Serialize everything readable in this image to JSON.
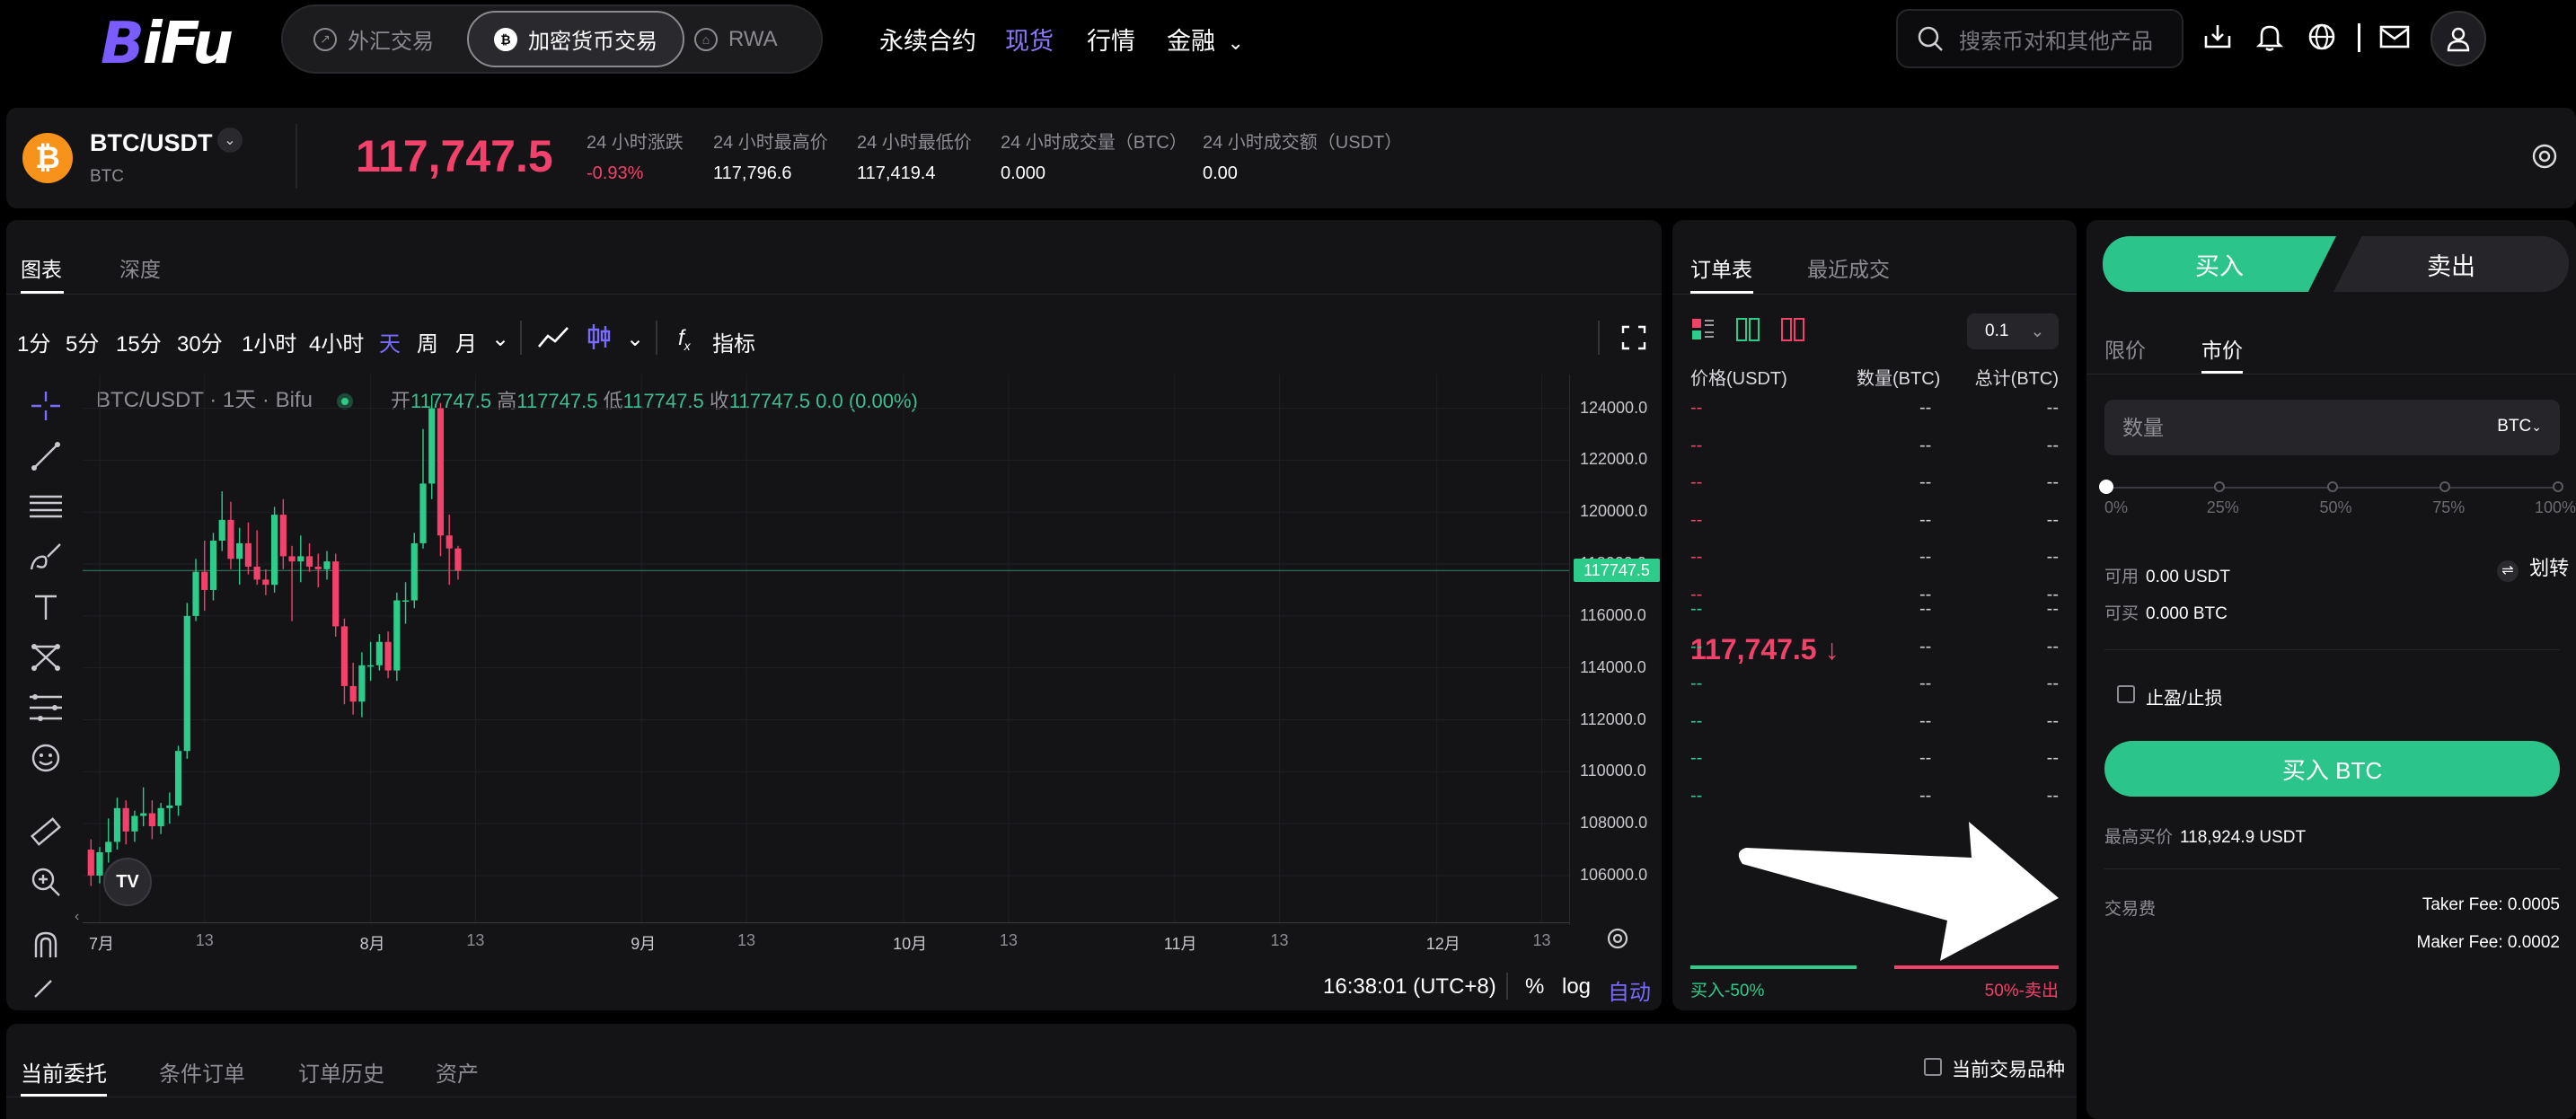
{
  "header": {
    "logo": "BiFu",
    "segments": [
      {
        "label": "外汇交易",
        "active": false
      },
      {
        "label": "加密货币交易",
        "active": true
      },
      {
        "label": "RWA",
        "active": false
      }
    ],
    "nav": [
      {
        "label": "永续合约",
        "active": false
      },
      {
        "label": "现货",
        "active": true
      },
      {
        "label": "行情",
        "active": false
      },
      {
        "label": "金融",
        "active": false
      }
    ],
    "search_placeholder": "搜索币对和其他产品",
    "icons": [
      "download-icon",
      "bell-icon",
      "globe-icon",
      "mail-icon",
      "user-icon"
    ]
  },
  "ticker": {
    "pair": "BTC/USDT",
    "base": "BTC",
    "last_price": "117,747.5",
    "stats": [
      {
        "label": "24 小时涨跌",
        "value": "-0.93%"
      },
      {
        "label": "24 小时最高价",
        "value": "117,796.6"
      },
      {
        "label": "24 小时最低价",
        "value": "117,419.4"
      },
      {
        "label": "24 小时成交量（BTC）",
        "value": "0.000"
      },
      {
        "label": "24 小时成交额（USDT）",
        "value": "0.00"
      }
    ]
  },
  "chart_panel": {
    "tabs": [
      "图表",
      "深度"
    ],
    "timeframes": [
      "1分",
      "5分",
      "15分",
      "30分",
      "1小时",
      "4小时",
      "天",
      "周",
      "月"
    ],
    "active_timeframe": "天",
    "indicator_label": "指标",
    "legend_title": "BTC/USDT · 1天 · Bifu",
    "ohlc": {
      "open_label": "开",
      "open": "117747.5",
      "high_label": "高",
      "high": "117747.5",
      "low_label": "低",
      "low": "117747.5",
      "close_label": "收",
      "close": "117747.5",
      "change": "0.0 (0.00%)"
    },
    "time": "16:38:01 (UTC+8)",
    "scale_options": [
      "%",
      "log",
      "自动"
    ]
  },
  "chart_data": {
    "type": "candlestick",
    "y_ticks": [
      124000.0,
      122000.0,
      120000.0,
      118000.0,
      116000.0,
      114000.0,
      112000.0,
      110000.0,
      108000.0,
      106000.0
    ],
    "y_tick_labels": [
      "124000.0",
      "122000.0",
      "120000.0",
      "118000.0",
      "116000.0",
      "114000.0",
      "112000.0",
      "110000.0",
      "108000.0",
      "106000.0"
    ],
    "ylim": [
      104200,
      125300
    ],
    "x_labels": [
      {
        "label": "7月",
        "major": true,
        "day": 0
      },
      {
        "label": "13",
        "major": false,
        "day": 12
      },
      {
        "label": "8月",
        "major": true,
        "day": 31
      },
      {
        "label": "13",
        "major": false,
        "day": 43
      },
      {
        "label": "9月",
        "major": true,
        "day": 62
      },
      {
        "label": "13",
        "major": false,
        "day": 74
      },
      {
        "label": "10月",
        "major": true,
        "day": 92
      },
      {
        "label": "13",
        "major": false,
        "day": 104
      },
      {
        "label": "11月",
        "major": true,
        "day": 123
      },
      {
        "label": "13",
        "major": false,
        "day": 135
      },
      {
        "label": "12月",
        "major": true,
        "day": 153
      },
      {
        "label": "13",
        "major": false,
        "day": 165
      }
    ],
    "last_price_label": "117747.5",
    "last_price": 117747.5,
    "candles": [
      [
        -1,
        107000,
        107400,
        105600,
        106000
      ],
      [
        0,
        106000,
        107100,
        105700,
        106900
      ],
      [
        1,
        106900,
        108200,
        106500,
        107300
      ],
      [
        2,
        107300,
        109000,
        107000,
        108600
      ],
      [
        3,
        108600,
        108900,
        107200,
        107700
      ],
      [
        4,
        107700,
        108500,
        107300,
        108300
      ],
      [
        5,
        108300,
        109400,
        107900,
        108400
      ],
      [
        6,
        108400,
        108900,
        107400,
        107900
      ],
      [
        7,
        107900,
        108800,
        107600,
        108600
      ],
      [
        8,
        108600,
        109200,
        108000,
        108700
      ],
      [
        9,
        108700,
        111000,
        108300,
        110800
      ],
      [
        10,
        110800,
        116500,
        110500,
        116000
      ],
      [
        11,
        116000,
        118200,
        115800,
        117700
      ],
      [
        12,
        117700,
        118900,
        116200,
        117000
      ],
      [
        13,
        117000,
        119200,
        116600,
        118900
      ],
      [
        14,
        118900,
        120800,
        118500,
        119700
      ],
      [
        15,
        119700,
        120400,
        117800,
        118200
      ],
      [
        16,
        118200,
        119400,
        117200,
        118800
      ],
      [
        17,
        118800,
        119600,
        117600,
        117900
      ],
      [
        18,
        117900,
        119300,
        117200,
        117400
      ],
      [
        19,
        117400,
        117800,
        116800,
        117200
      ],
      [
        20,
        117200,
        120200,
        116900,
        119900
      ],
      [
        21,
        119900,
        120500,
        117800,
        118300
      ],
      [
        22,
        118300,
        118700,
        115800,
        118100
      ],
      [
        23,
        118100,
        119100,
        117300,
        118300
      ],
      [
        24,
        118300,
        118800,
        117700,
        117900
      ],
      [
        25,
        117900,
        118400,
        117100,
        117800
      ],
      [
        26,
        117800,
        118500,
        117400,
        118100
      ],
      [
        27,
        118100,
        118400,
        115200,
        115600
      ],
      [
        28,
        115600,
        115900,
        112600,
        113300
      ],
      [
        29,
        113300,
        114200,
        112200,
        112700
      ],
      [
        30,
        112700,
        114600,
        112100,
        114100
      ],
      [
        31,
        114100,
        115000,
        113500,
        114100
      ],
      [
        32,
        114100,
        115300,
        113900,
        115000
      ],
      [
        33,
        115000,
        115400,
        113600,
        113900
      ],
      [
        34,
        113900,
        116900,
        113500,
        116600
      ],
      [
        35,
        116600,
        117300,
        115700,
        116600
      ],
      [
        36,
        116600,
        119200,
        116300,
        118800
      ],
      [
        37,
        118800,
        123200,
        118600,
        121100
      ],
      [
        38,
        121100,
        124500,
        120500,
        124000
      ],
      [
        39,
        124000,
        124200,
        118300,
        119100
      ],
      [
        40,
        119100,
        119900,
        117200,
        118600
      ],
      [
        41,
        118600,
        118700,
        117400,
        117747.5
      ]
    ]
  },
  "orderbook": {
    "tabs": [
      "订单表",
      "最近成交"
    ],
    "precision": "0.1",
    "headers": [
      "价格(USDT)",
      "数量(BTC)",
      "总计(BTC)"
    ],
    "asks": [
      [
        "--",
        "--",
        "--"
      ],
      [
        "--",
        "--",
        "--"
      ],
      [
        "--",
        "--",
        "--"
      ],
      [
        "--",
        "--",
        "--"
      ],
      [
        "--",
        "--",
        "--"
      ],
      [
        "--",
        "--",
        "--"
      ]
    ],
    "mid_price": "117,747.5 ↓",
    "bids": [
      [
        "--",
        "--",
        "--"
      ],
      [
        "--",
        "--",
        "--"
      ],
      [
        "--",
        "--",
        "--"
      ],
      [
        "--",
        "--",
        "--"
      ],
      [
        "--",
        "--",
        "--"
      ],
      [
        "--",
        "--",
        "--"
      ]
    ],
    "buy_pct": "买入-50%",
    "sell_pct": "50%-卖出",
    "buy_ratio": 0.5
  },
  "trade": {
    "buy_tab": "买入",
    "sell_tab": "卖出",
    "order_types": [
      "限价",
      "市价"
    ],
    "active_order_type": "市价",
    "qty_placeholder": "数量",
    "qty_unit": "BTC",
    "slider_marks": [
      "0%",
      "25%",
      "50%",
      "75%",
      "100%"
    ],
    "slider_value": 0,
    "transfer": "划转",
    "available_label": "可用",
    "available_value": "0.00 USDT",
    "can_buy_label": "可买",
    "can_buy_value": "0.000 BTC",
    "tpsl_label": "止盈/止损",
    "buy_button": "买入 BTC",
    "max_buy_label": "最高买价",
    "max_buy_value": "118,924.9 USDT",
    "fee_label": "交易费",
    "taker_fee": "Taker Fee:  0.0005",
    "maker_fee": "Maker Fee:  0.0002"
  },
  "bottom": {
    "tabs": [
      "当前委托",
      "条件订单",
      "订单历史",
      "资产"
    ],
    "current_only": "当前交易品种"
  },
  "colors": {
    "accent": "#8c7bff",
    "up": "#2ecc8a",
    "down": "#f2416b",
    "panel": "#141417",
    "bitcoin": "#f7931a"
  }
}
